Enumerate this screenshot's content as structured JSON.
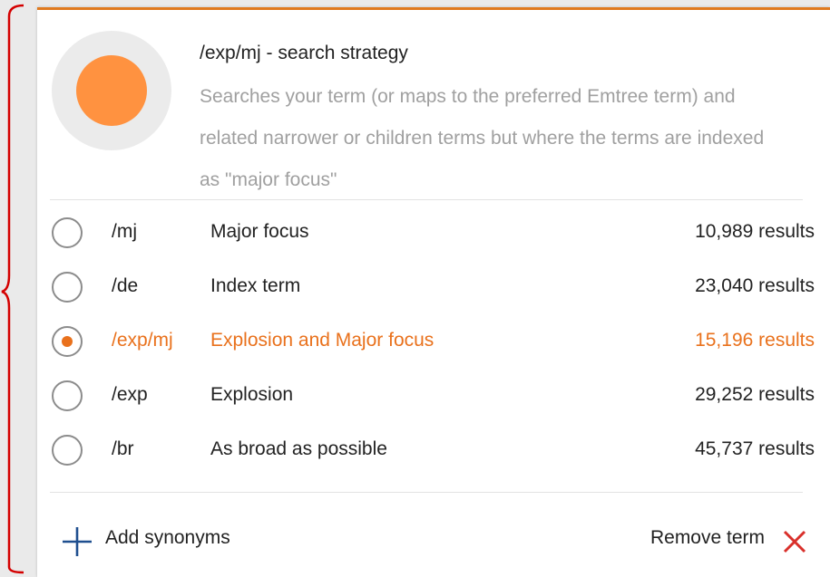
{
  "strategy": {
    "title": "/exp/mj - search strategy",
    "description": "Searches your term (or maps to the preferred Emtree term) and related narrower or children terms but where the terms are indexed as \"major focus\"",
    "icon": "filled-circle-icon",
    "icon_color": "#ff9240"
  },
  "options": [
    {
      "code": "/mj",
      "label": "Major focus",
      "count": "10,989 results",
      "selected": false
    },
    {
      "code": "/de",
      "label": "Index term",
      "count": "23,040 results",
      "selected": false
    },
    {
      "code": "/exp/mj",
      "label": "Explosion and Major focus",
      "count": "15,196 results",
      "selected": true
    },
    {
      "code": "/exp",
      "label": "Explosion",
      "count": "29,252 results",
      "selected": false
    },
    {
      "code": "/br",
      "label": "As broad as possible",
      "count": "45,737 results",
      "selected": false
    }
  ],
  "footer": {
    "add_synonyms_label": "Add synonyms",
    "add_icon": "plus-icon",
    "remove_term_label": "Remove term",
    "remove_icon": "close-icon"
  },
  "colors": {
    "accent": "#e9711c",
    "remove_x": "#d9302b",
    "plus": "#1f4f8f",
    "annotation_bracket": "#d40000"
  }
}
